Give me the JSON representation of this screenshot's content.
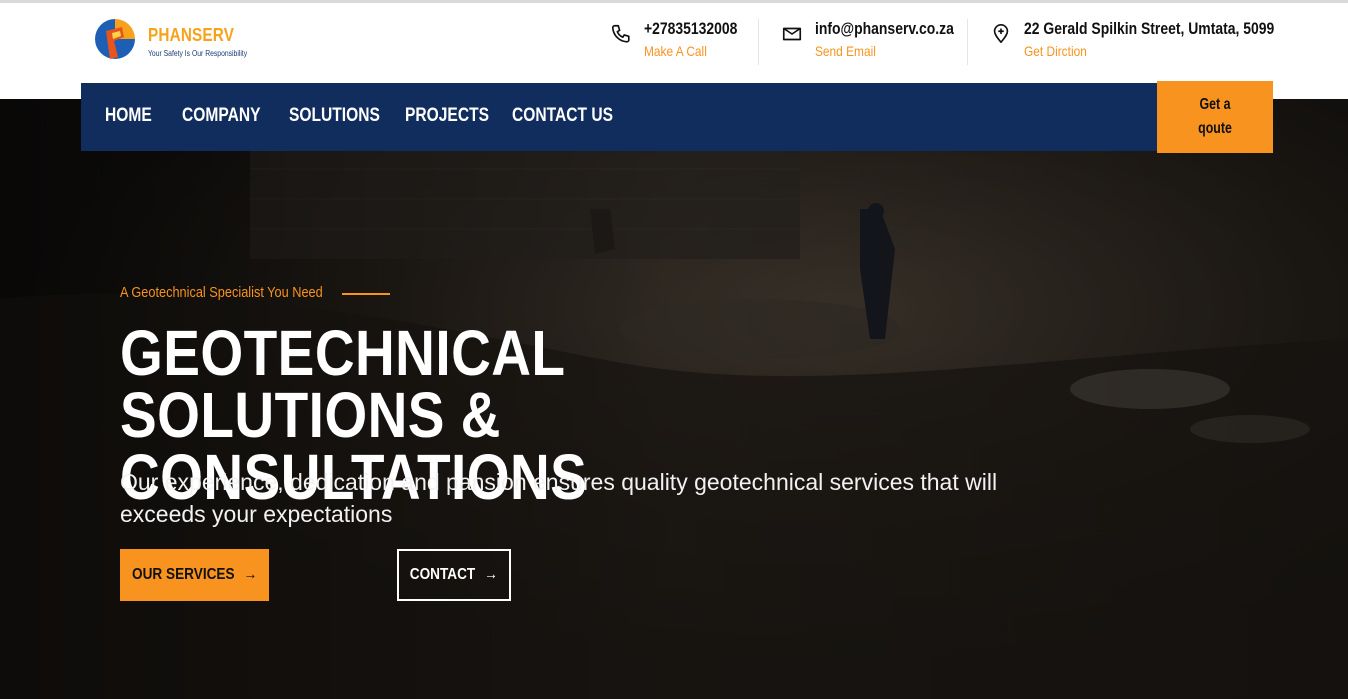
{
  "brand": {
    "name": "PHANSERV",
    "tagline": "Your Safety Is Our Responsibility"
  },
  "contacts": [
    {
      "icon": "phone-icon",
      "main": "+27835132008",
      "sub": "Make A Call"
    },
    {
      "icon": "envelope-icon",
      "main": "info@phanserv.co.za",
      "sub": "Send Email"
    },
    {
      "icon": "location-pin-icon",
      "main": "22 Gerald Spilkin Street, Umtata, 5099",
      "sub": "Get Dirction"
    }
  ],
  "nav": {
    "items": [
      "HOME",
      "COMPANY",
      "SOLUTIONS",
      "PROJECTS",
      "CONTACT US"
    ],
    "quote_line1": "Get a",
    "quote_line2": "qoute"
  },
  "hero": {
    "tagline": "A Geotechnical Specialist You Need",
    "headline_line1": "GEOTECHNICAL SOLUTIONS &",
    "headline_line2": "CONSULTATIONS",
    "subtext": "Our experience, dedication and pansion ensures quality geotechnical services that will exceeds your expectations",
    "services_button": "OUR SERVICES",
    "contact_button": "CONTACT",
    "arrow": "→"
  },
  "colors": {
    "accent": "#f7931e",
    "nav_bg": "#112d5e",
    "brand_blue": "#1e3a78"
  }
}
